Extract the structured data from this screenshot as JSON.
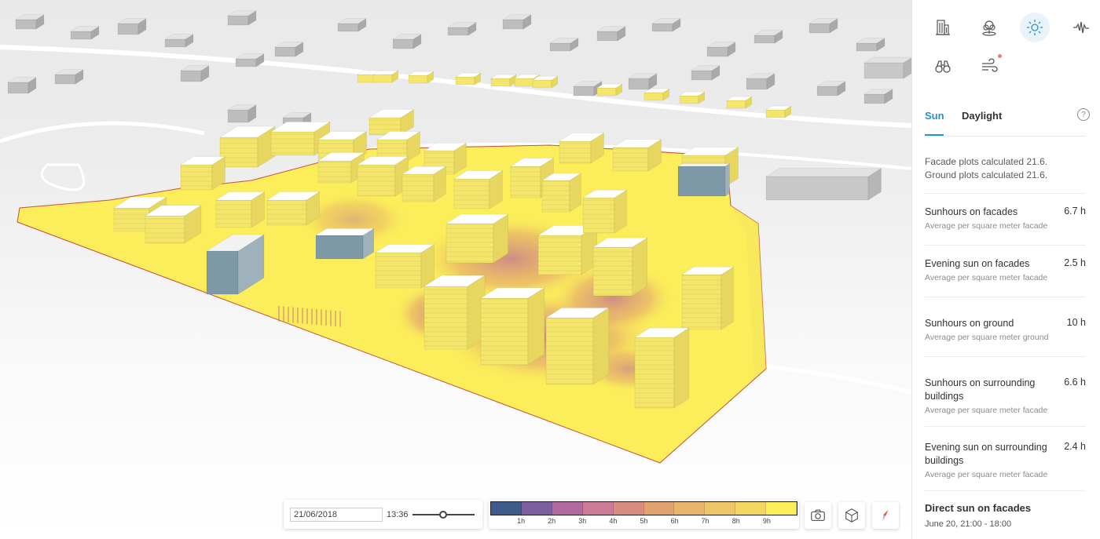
{
  "toolbar": {
    "tools": [
      {
        "name": "buildings-tool",
        "icon": "buildings-icon",
        "active": false
      },
      {
        "name": "trees-tool",
        "icon": "tree-icon",
        "active": false
      },
      {
        "name": "sun-tool",
        "icon": "sun-icon",
        "active": true
      },
      {
        "name": "noise-tool",
        "icon": "sound-wave-icon",
        "active": false
      },
      {
        "name": "view-tool",
        "icon": "binoculars-icon",
        "active": false
      },
      {
        "name": "wind-tool",
        "icon": "wind-icon",
        "active": false,
        "notification": true
      }
    ]
  },
  "tabs": {
    "sun": "Sun",
    "daylight": "Daylight",
    "help": "?"
  },
  "calc": {
    "facade": "Facade plots calculated 21.6.",
    "ground": "Ground plots calculated 21.6."
  },
  "metrics": [
    {
      "label": "Sunhours on facades",
      "value": "6.7 h",
      "sub": "Average per square meter facade"
    },
    {
      "label": "Evening sun on facades",
      "value": "2.5 h",
      "sub": "Average per square meter facade"
    },
    {
      "label": "Sunhours on ground",
      "value": "10 h",
      "sub": "Average per square meter ground"
    },
    {
      "label": "Sunhours on surrounding buildings",
      "value": "6.6 h",
      "sub": "Average per square meter facade"
    },
    {
      "label": "Evening sun on surrounding buildings",
      "value": "2.4 h",
      "sub": "Average per square meter facade"
    }
  ],
  "direct_sun": {
    "title": "Direct sun on facades",
    "range": "June 20, 21:00 - 18:00"
  },
  "controls": {
    "date": "21/06/2018",
    "time": "13:36",
    "time_slider_fraction": 0.49
  },
  "legend": {
    "colors": [
      "#3d5a8a",
      "#7b5fa0",
      "#b06aa0",
      "#cc7a95",
      "#db8c80",
      "#e3a272",
      "#e9b46c",
      "#efc566",
      "#f4d762",
      "#fbee5a"
    ],
    "labels": [
      "1h",
      "2h",
      "3h",
      "4h",
      "5h",
      "6h",
      "7h",
      "8h",
      "9h"
    ]
  },
  "scene": {
    "ground_color": "#fbee5a",
    "shade_color": "#d99082",
    "roof_color": "#ffffff",
    "facade_color": "#f3e66a",
    "shadowed_facade_color": "#7d98a6",
    "context_building_color": "#d3d3d3"
  },
  "action_icons": [
    "camera-icon",
    "cube-icon",
    "compass-icon"
  ]
}
